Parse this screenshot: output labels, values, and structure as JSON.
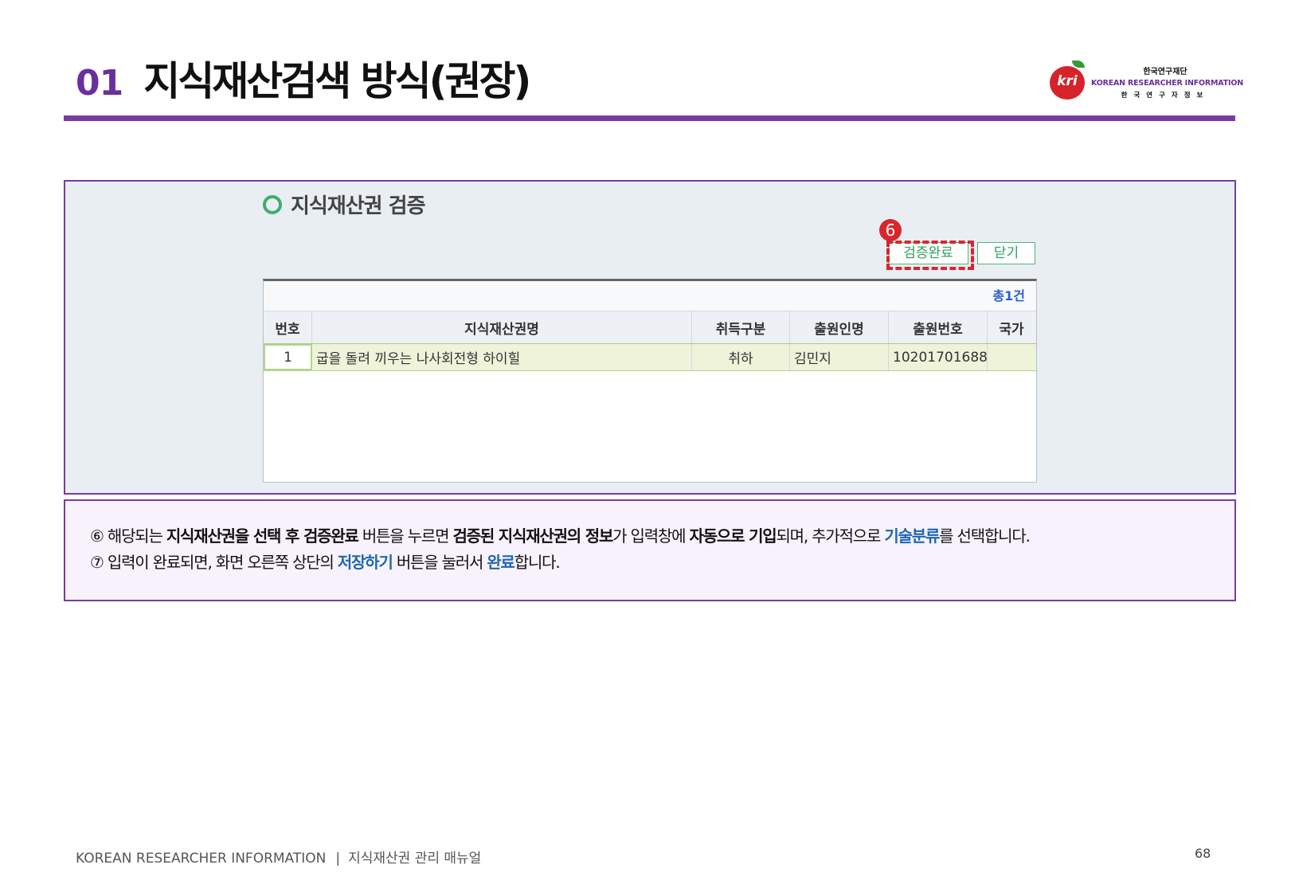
{
  "header": {
    "number": "01",
    "title": "지식재산검색 방식(권장)"
  },
  "logo": {
    "mark": "kri",
    "line_ko": "한국연구재단",
    "line_en": "KOREAN RESEARCHER INFORMATION",
    "line_ko2": "한국연구자정보"
  },
  "panel": {
    "section_title": "지식재산권 검증",
    "step_badge": "6",
    "verify_button": "검증완료",
    "close_button": "닫기",
    "total": "총1건",
    "columns": [
      "번호",
      "지식재산권명",
      "취득구분",
      "출원인명",
      "출원번호",
      "국가"
    ],
    "rows": [
      [
        "1",
        "굽을 돌려 끼우는 나사회전형 하이힐",
        "취하",
        "김민지",
        "10201701688",
        ""
      ]
    ]
  },
  "description": {
    "line1": {
      "p1": "⑥ 해당되는 ",
      "b1": "지식재산권을 선택 후 검증완료",
      "p2": " 버튼을 누르면 ",
      "b2": "검증된 지식재산권의 정보",
      "p3": "가 입력창에 ",
      "b3": "자동으로 기입",
      "p4": "되며, 추가적으로 ",
      "h1": "기술분류",
      "p5": "를 선택합니다."
    },
    "line2": {
      "p1": "⑦ 입력이 완료되면, 화면 오른쪽 상단의 ",
      "h1": "저장하기",
      "p2": " 버튼을 눌러서 ",
      "h2": "완료",
      "p3": "합니다."
    }
  },
  "footer": {
    "org": "KOREAN RESEARCHER INFORMATION",
    "separator": "|",
    "doc": "지식재산권 관리 매뉴얼",
    "page": "68"
  },
  "colors": {
    "accent_purple": "#7a3aa5",
    "button_green": "#49b87a",
    "highlight_red": "#d9262c",
    "link_blue": "#1d67b3"
  }
}
